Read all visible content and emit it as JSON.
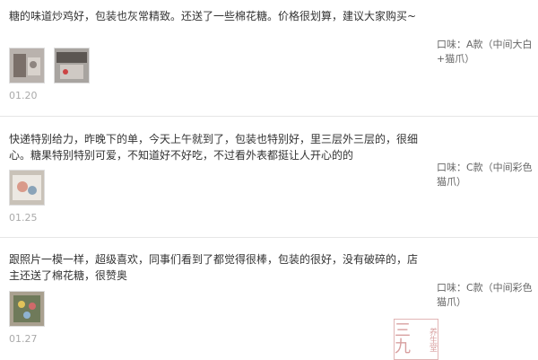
{
  "reviews": [
    {
      "text": "糖的味道炒鸡好，包装也灰常精致。还送了一些棉花糖。价格很划算，建议大家购买~",
      "date": "01.20",
      "flavor_line1": "口味：A款（中间大白",
      "flavor_line2": "+猫爪）",
      "thumbs": [
        "photo-1",
        "photo-2"
      ]
    },
    {
      "text": "快递特别给力，昨晚下的单，今天上午就到了，包装也特别好，里三层外三层的，很细心。糖果特别特别可爱，不知道好不好吃，不过看外表都挺让人开心的的",
      "date": "01.25",
      "flavor_line1": "口味：C款（中间彩色",
      "flavor_line2": "猫爪）",
      "thumbs": [
        "photo-1"
      ]
    },
    {
      "text": "跟照片一模一样，超级喜欢，同事们看到了都觉得很棒，包装的很好，没有破碎的，店主还送了棉花糖，很赞奥",
      "date": "01.27",
      "flavor_line1": "口味：C款（中间彩色",
      "flavor_line2": "猫爪）",
      "thumbs": [
        "photo-1"
      ]
    }
  ],
  "watermark": {
    "big": "三九",
    "small": "养生堂"
  }
}
